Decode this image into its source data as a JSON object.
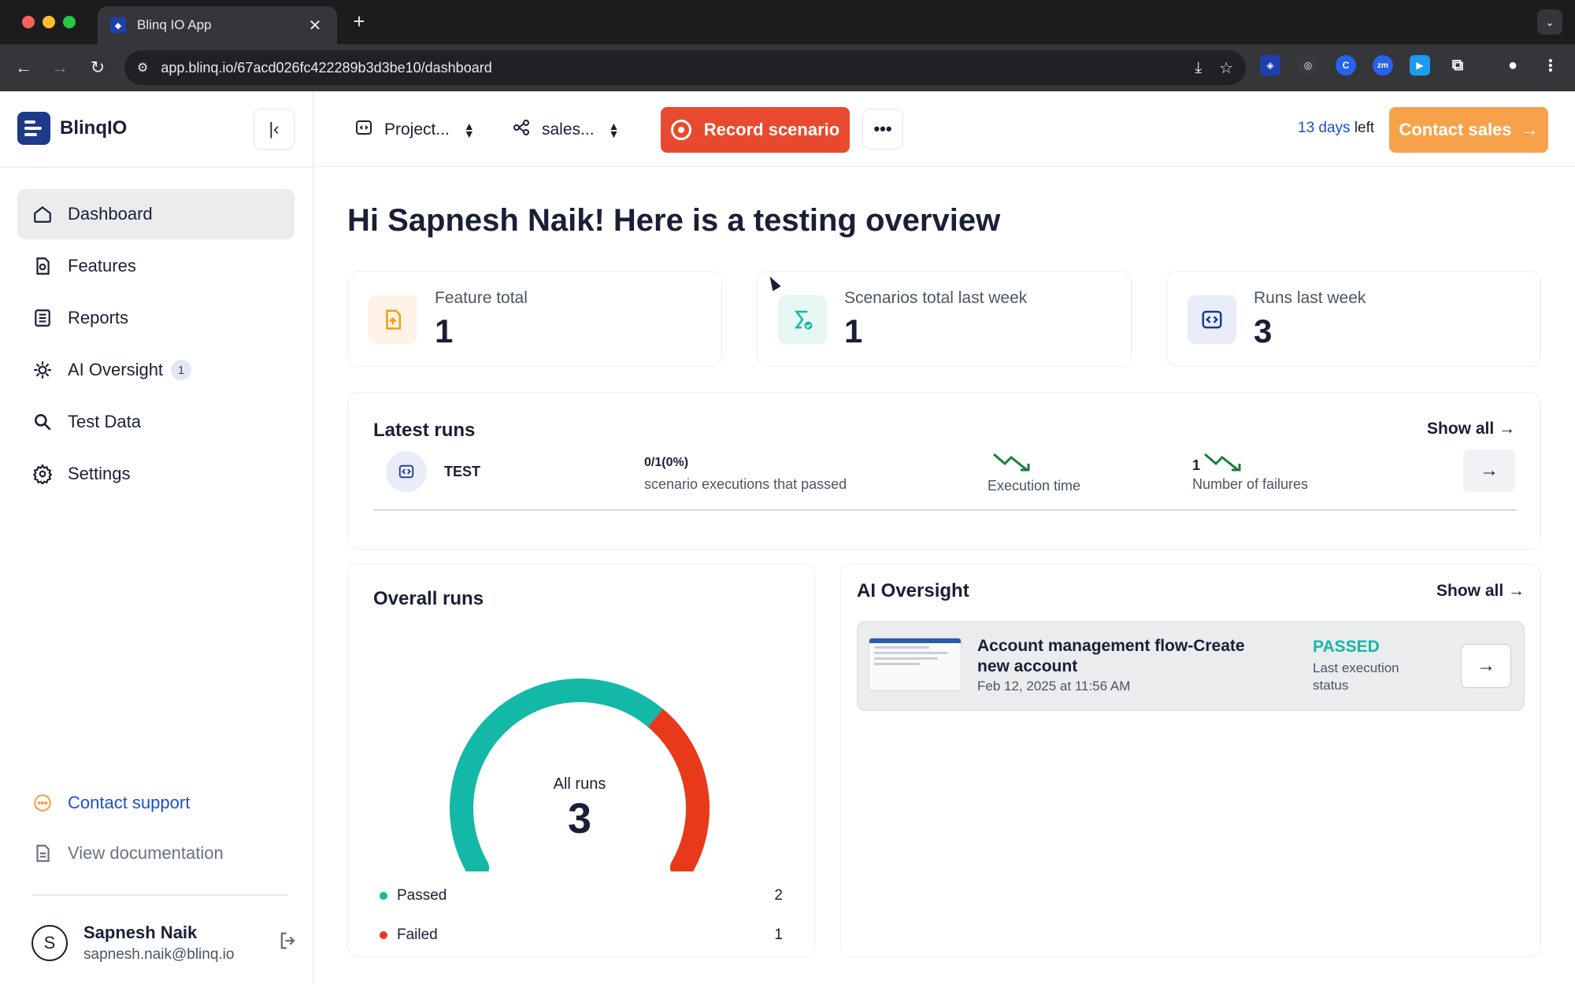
{
  "browser": {
    "tab_title": "Blinq IO App",
    "url": "app.blinq.io/67acd026fc422289b3d3be10/dashboard",
    "colors": {
      "chrome_bg": "#202124",
      "toolbar_bg": "#35363a"
    }
  },
  "sidebar": {
    "brand": "BlinqIO",
    "items": [
      {
        "label": "Dashboard",
        "icon": "home-icon",
        "active": true
      },
      {
        "label": "Features",
        "icon": "features-icon"
      },
      {
        "label": "Reports",
        "icon": "reports-icon"
      },
      {
        "label": "AI Oversight",
        "icon": "ai-oversight-icon",
        "badge": "1"
      },
      {
        "label": "Test Data",
        "icon": "search-icon"
      },
      {
        "label": "Settings",
        "icon": "gear-icon"
      }
    ],
    "contact_support": "Contact support",
    "view_documentation": "View documentation",
    "user": {
      "initial": "S",
      "name": "Sapnesh Naik",
      "email": "sapnesh.naik@blinq.io"
    }
  },
  "topbar": {
    "project_selector": "Project...",
    "env_selector": "sales...",
    "record_button": "Record scenario",
    "trial_days": "13 days",
    "trial_suffix": " left",
    "contact_sales": "Contact sales"
  },
  "main": {
    "heading": "Hi Sapnesh Naik! Here is a testing overview",
    "stats": [
      {
        "label": "Feature total",
        "value": "1",
        "icon": "file-upload-icon",
        "color": "#f59e0b"
      },
      {
        "label": "Scenarios total last week",
        "value": "1",
        "icon": "scenario-icon",
        "color": "#14b8a6"
      },
      {
        "label": "Runs last week",
        "value": "3",
        "icon": "code-icon",
        "color": "#1e3a8a"
      }
    ],
    "latest_runs": {
      "title": "Latest runs",
      "show_all": "Show all",
      "rows": [
        {
          "name": "TEST",
          "ratio": "0/1(0%)",
          "ratio_label": "scenario executions that passed",
          "exec_label": "Execution time",
          "failures": "1",
          "failures_label": "Number of failures"
        }
      ]
    },
    "overall_runs": {
      "title": "Overall runs",
      "center_label": "All runs",
      "total": "3",
      "legend": [
        {
          "label": "Passed",
          "value": "2",
          "color": "#14b8a6"
        },
        {
          "label": "Failed",
          "value": "1",
          "color": "#e8391b"
        }
      ]
    },
    "ai_oversight": {
      "title": "AI Oversight",
      "show_all": "Show all",
      "items": [
        {
          "title": "Account management flow-Create new account",
          "date": "Feb 12, 2025 at 11:56 AM",
          "status": "PASSED",
          "status_label": "Last execution status"
        }
      ]
    }
  },
  "chart_data": {
    "type": "pie",
    "title": "Overall runs",
    "categories": [
      "Passed",
      "Failed"
    ],
    "values": [
      2,
      1
    ],
    "colors": [
      "#14b8a6",
      "#e8391b"
    ]
  }
}
